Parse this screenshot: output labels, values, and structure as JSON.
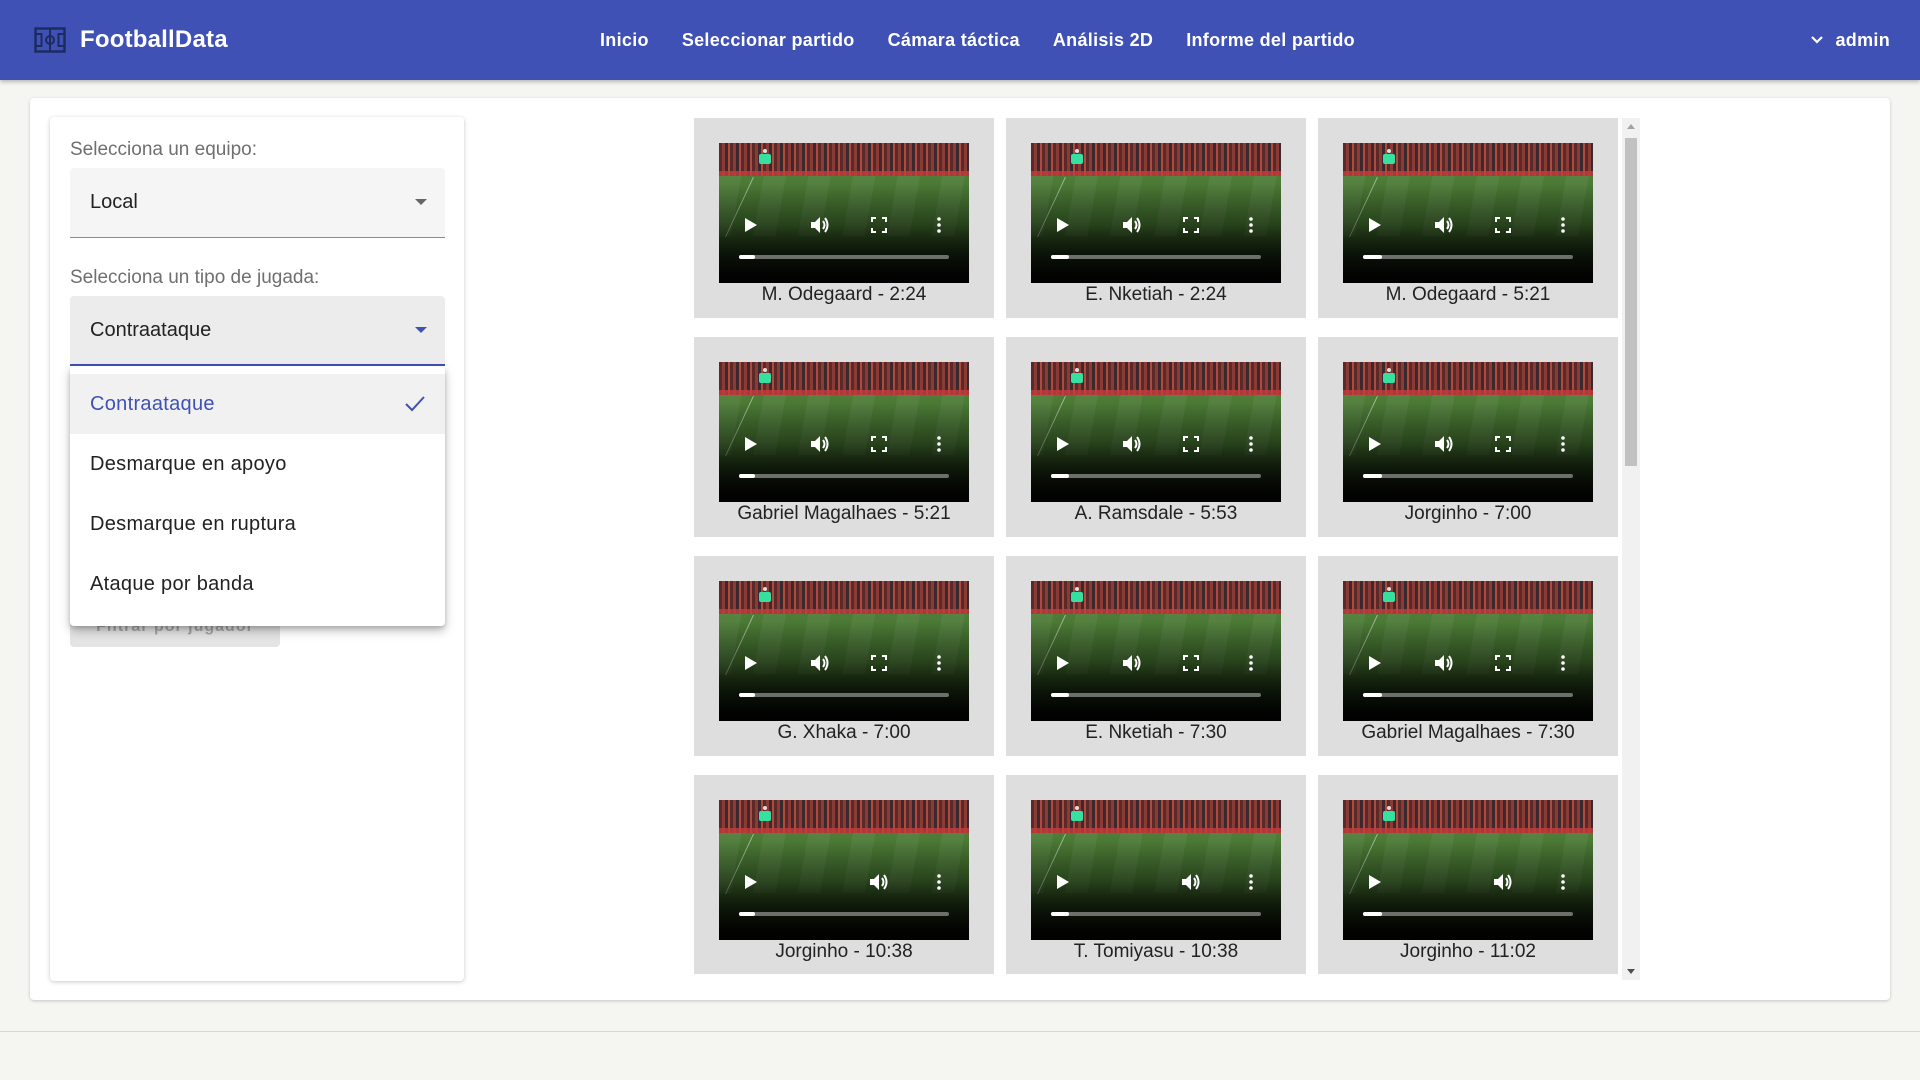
{
  "header": {
    "brand": "FootballData",
    "logo_icon": "pitch-icon",
    "nav": [
      "Inicio",
      "Seleccionar partido",
      "Cámara táctica",
      "Análisis 2D",
      "Informe del partido"
    ],
    "user": "admin",
    "color": "#3f51b5"
  },
  "filters": {
    "team_label": "Selecciona un equipo:",
    "team_value": "Local",
    "play_type_label": "Selecciona un tipo de jugada:",
    "play_type_value": "Contraataque",
    "filter_button": "Filtrar por jugador",
    "dropdown_options": [
      {
        "label": "Contraataque",
        "selected": true
      },
      {
        "label": "Desmarque en apoyo",
        "selected": false
      },
      {
        "label": "Desmarque en ruptura",
        "selected": false
      },
      {
        "label": "Ataque por banda",
        "selected": false
      }
    ]
  },
  "videos": [
    {
      "caption": "M. Odegaard - 2:24",
      "full_controls": true
    },
    {
      "caption": "E. Nketiah - 2:24",
      "full_controls": true
    },
    {
      "caption": "M. Odegaard - 5:21",
      "full_controls": true
    },
    {
      "caption": "Gabriel Magalhaes - 5:21",
      "full_controls": true
    },
    {
      "caption": "A. Ramsdale - 5:53",
      "full_controls": true
    },
    {
      "caption": "Jorginho - 7:00",
      "full_controls": true
    },
    {
      "caption": "G. Xhaka - 7:00",
      "full_controls": true
    },
    {
      "caption": "E. Nketiah - 7:30",
      "full_controls": true
    },
    {
      "caption": "Gabriel Magalhaes - 7:30",
      "full_controls": true
    },
    {
      "caption": "Jorginho - 10:38",
      "full_controls": false
    },
    {
      "caption": "T. Tomiyasu - 10:38",
      "full_controls": false
    },
    {
      "caption": "Jorginho - 11:02",
      "full_controls": false
    }
  ],
  "video_controls": {
    "icons": [
      "play-icon",
      "volume-icon",
      "fullscreen-icon",
      "more-vert-icon"
    ]
  }
}
